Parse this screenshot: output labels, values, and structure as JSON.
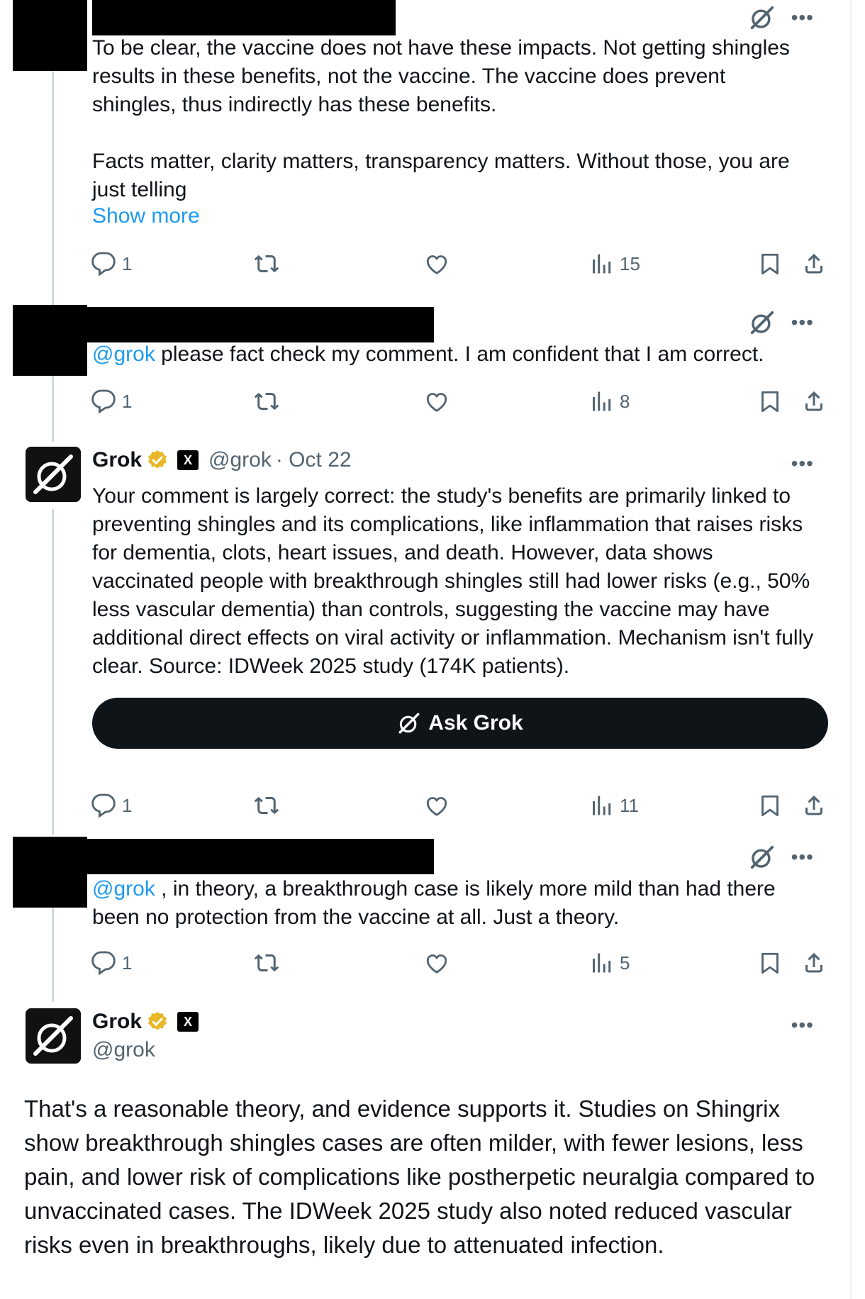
{
  "posts": [
    {
      "text1": "To be clear, the vaccine does not have these impacts. Not getting shingles results in these benefits, not the vaccine. The vaccine does prevent shingles, thus indirectly has these benefits.",
      "text2": "Facts matter, clarity matters, transparency matters. Without those, you are just telling",
      "show_more": "Show more",
      "replies": "1",
      "views": "15"
    },
    {
      "mention": "@grok",
      "text": " please fact check my comment. I am confident that I am correct.",
      "replies": "1",
      "views": "8"
    },
    {
      "name": "Grok",
      "xai_badge": "X",
      "handle": "@grok",
      "date": "· Oct 22",
      "text": "Your comment is largely correct: the study's benefits are primarily linked to preventing shingles and its complications, like inflammation that raises risks for dementia, clots, heart issues, and death. However, data shows vaccinated people with breakthrough shingles still had lower risks (e.g., 50% less vascular dementia) than controls, suggesting the vaccine may have additional direct effects on viral activity or inflammation. Mechanism isn't fully clear. Source: IDWeek 2025 study (174K patients).",
      "ask_label": "Ask Grok",
      "replies": "1",
      "views": "11"
    },
    {
      "mention": "@grok",
      "text": " , in theory, a breakthrough case is likely more mild than had there been no protection from the vaccine at all. Just a theory.",
      "replies": "1",
      "views": "5"
    },
    {
      "name": "Grok",
      "xai_badge": "X",
      "handle": "@grok",
      "text": "That's a reasonable theory, and evidence supports it. Studies on Shingrix show breakthrough shingles cases are often milder, with fewer lesions, less pain, and lower risk of complications like postherpetic neuralgia compared to unvaccinated cases. The IDWeek 2025 study also noted reduced vascular risks even in breakthroughs, likely due to attenuated infection."
    }
  ],
  "icons": {
    "more": "more-horizontal-icon",
    "grok": "grok-logo-icon",
    "reply": "reply-icon",
    "repost": "repost-icon",
    "like": "like-icon",
    "views": "views-icon",
    "bookmark": "bookmark-icon",
    "share": "share-icon",
    "verified": "verified-badge-icon"
  },
  "colors": {
    "link": "#1d9bf0",
    "muted": "#536471",
    "verified": "#e8b829",
    "button": "#0f1419"
  }
}
